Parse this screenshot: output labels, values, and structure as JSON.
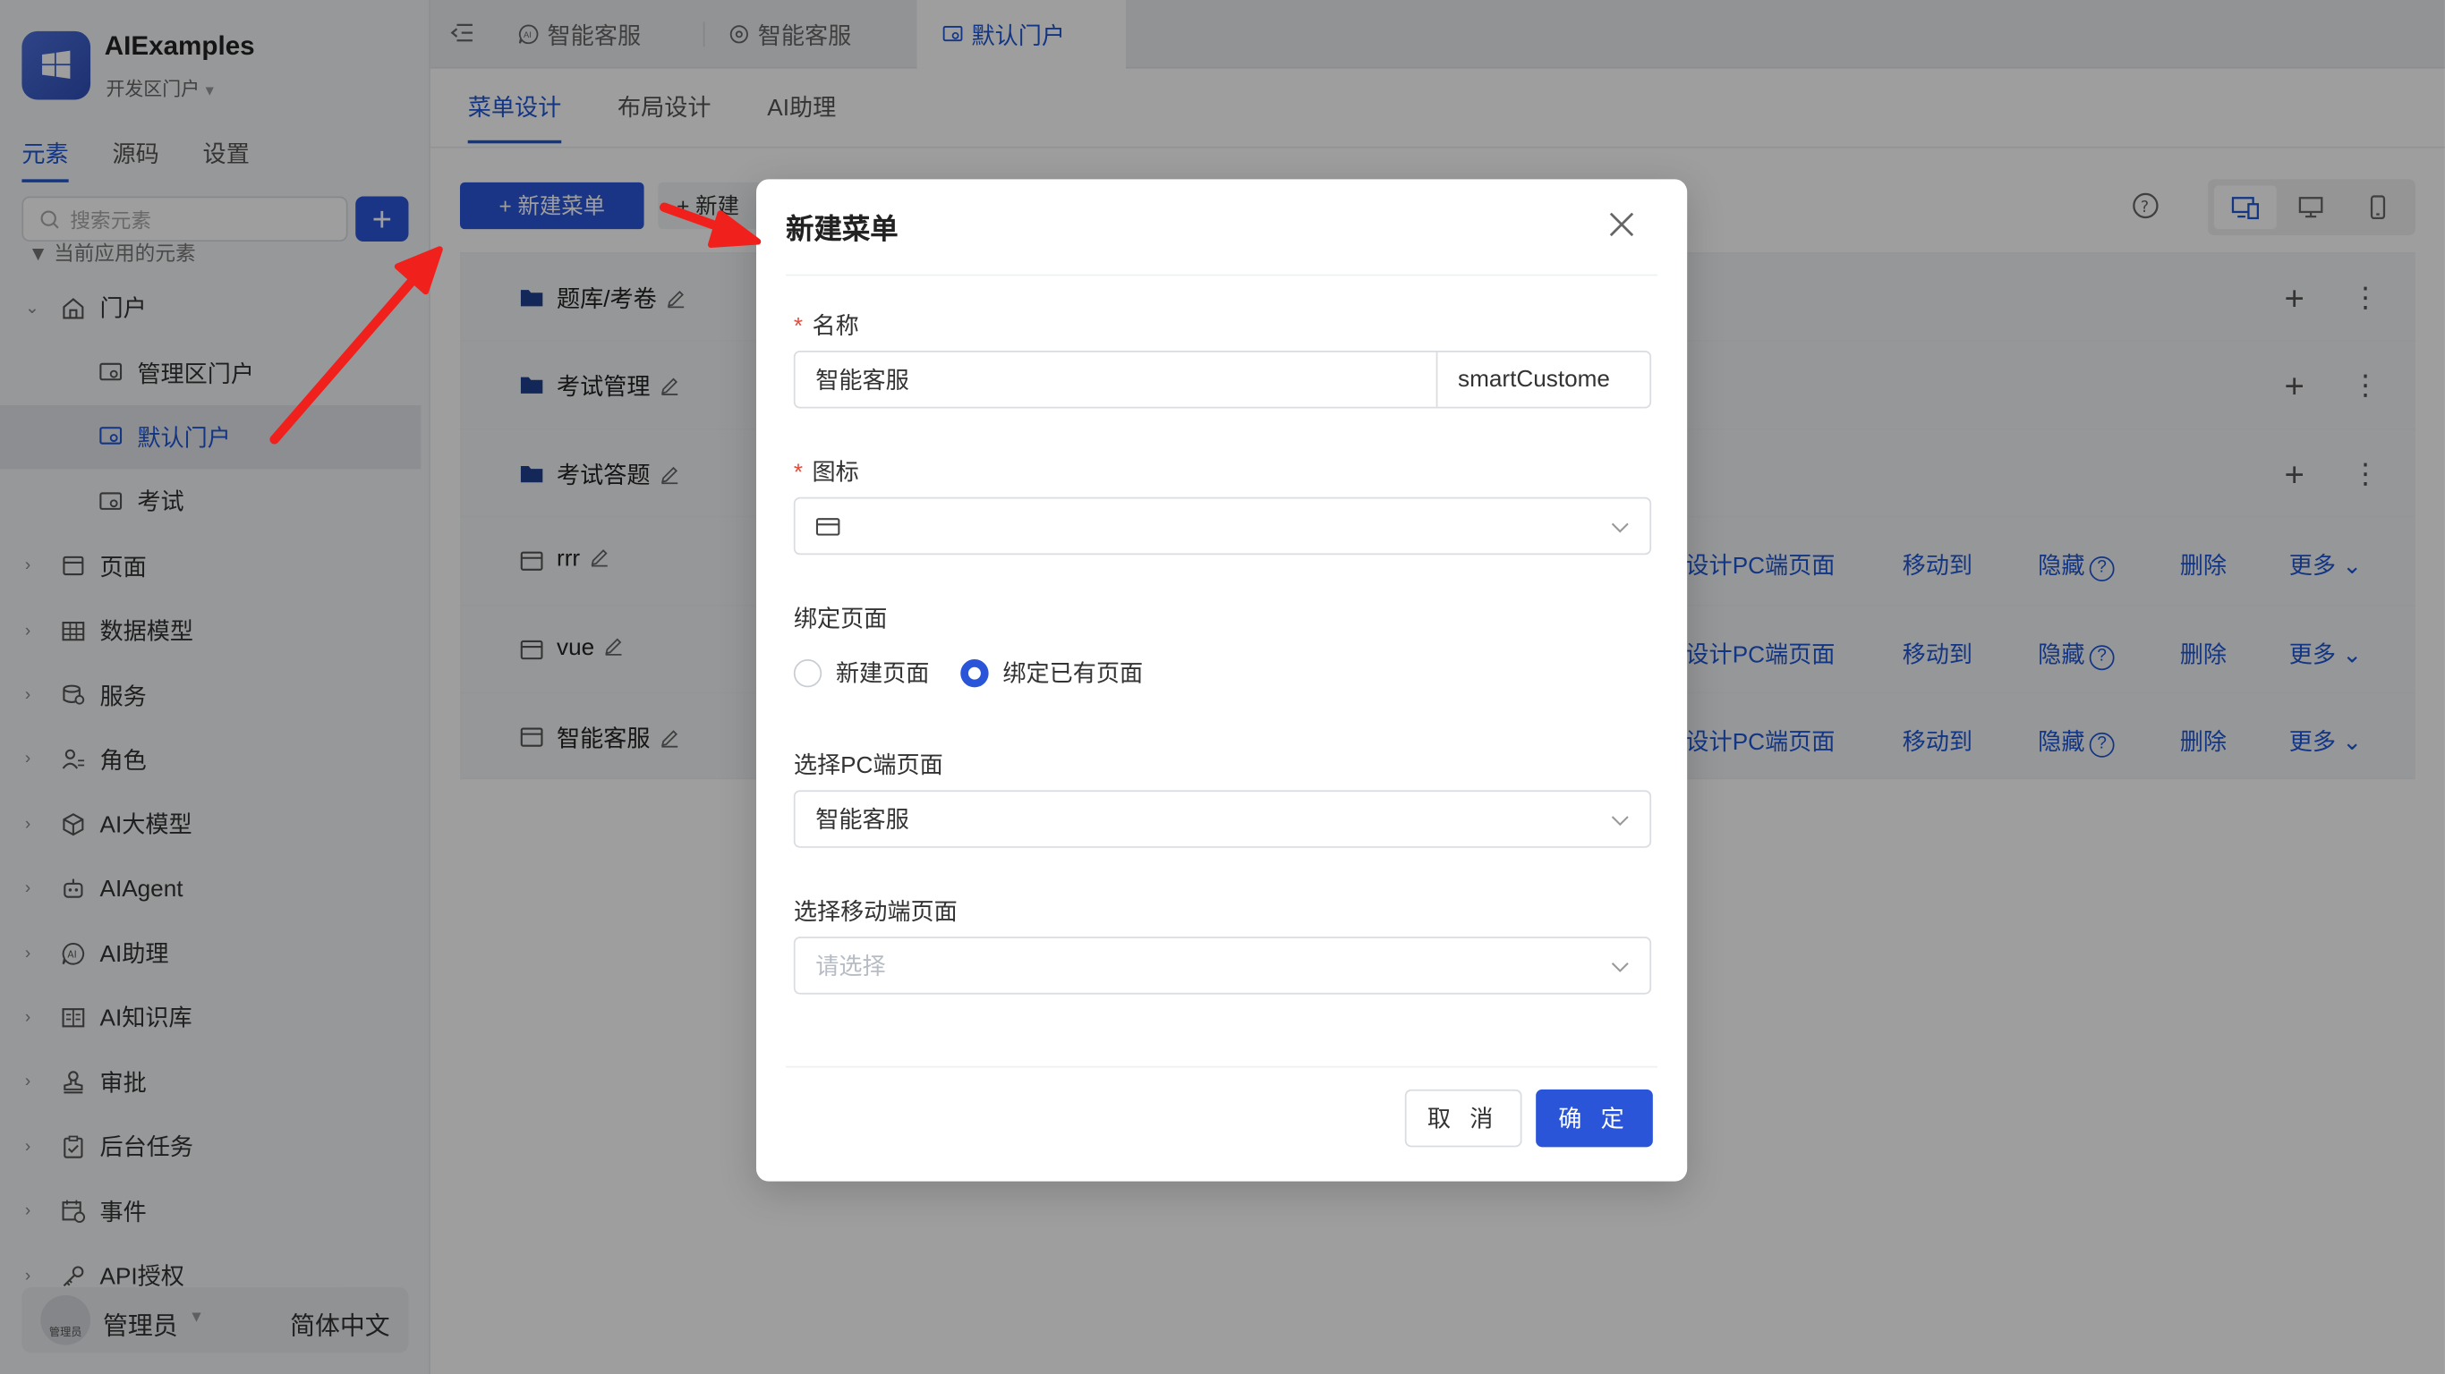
{
  "app": {
    "name": "AIExamples",
    "portal": "开发区门户"
  },
  "sidebar": {
    "tabs": [
      "元素",
      "源码",
      "设置"
    ],
    "search_placeholder": "搜索元素",
    "current_section": "当前应用的元素",
    "tree": [
      {
        "label": "门户",
        "icon": "home-icon",
        "expanded": true
      },
      {
        "label": "管理区门户",
        "icon": "portal-icon"
      },
      {
        "label": "默认门户",
        "icon": "portal-icon",
        "selected": true
      },
      {
        "label": "考试",
        "icon": "portal-icon"
      },
      {
        "label": "页面",
        "icon": "page-icon"
      },
      {
        "label": "数据模型",
        "icon": "table-icon"
      },
      {
        "label": "服务",
        "icon": "service-icon"
      },
      {
        "label": "角色",
        "icon": "role-icon"
      },
      {
        "label": "AI大模型",
        "icon": "cube-icon"
      },
      {
        "label": "AIAgent",
        "icon": "robot-icon"
      },
      {
        "label": "AI助理",
        "icon": "ai-assistant-icon"
      },
      {
        "label": "AI知识库",
        "icon": "book-icon"
      },
      {
        "label": "审批",
        "icon": "stamp-icon"
      },
      {
        "label": "后台任务",
        "icon": "task-icon"
      },
      {
        "label": "事件",
        "icon": "event-icon"
      },
      {
        "label": "API授权",
        "icon": "key-icon"
      }
    ],
    "footer": {
      "avatar_label": "管理员",
      "user": "管理员",
      "language": "简体中文"
    }
  },
  "topbar": {
    "tabs": [
      {
        "label": "智能客服",
        "icon": "ai-assistant-icon"
      },
      {
        "label": "智能客服",
        "icon": "page-icon"
      },
      {
        "label": "默认门户",
        "icon": "portal-icon",
        "active": true
      }
    ]
  },
  "main": {
    "subtabs": [
      "菜单设计",
      "布局设计",
      "AI助理"
    ],
    "new_menu_button": "+ 新建菜单",
    "new_second_button": "+ 新建",
    "rows": [
      {
        "label": "题库/考卷",
        "type": "folder"
      },
      {
        "label": "考试管理",
        "type": "folder"
      },
      {
        "label": "考试答题",
        "type": "folder"
      },
      {
        "label": "rrr",
        "type": "page"
      },
      {
        "label": "vue",
        "type": "page"
      },
      {
        "label": "智能客服",
        "type": "page"
      }
    ],
    "row_actions": {
      "design_pc": "设计PC端页面",
      "move_to": "移动到",
      "hide": "隐藏",
      "delete": "删除",
      "more": "更多"
    }
  },
  "modal": {
    "title": "新建菜单",
    "name_label": "名称",
    "name_value": "智能客服",
    "code_value": "smartCustome",
    "icon_label": "图标",
    "bind_label": "绑定页面",
    "radio_new": "新建页面",
    "radio_existing": "绑定已有页面",
    "pc_label": "选择PC端页面",
    "pc_value": "智能客服",
    "mobile_label": "选择移动端页面",
    "mobile_placeholder": "请选择",
    "cancel": "取 消",
    "ok": "确 定"
  },
  "colors": {
    "accent": "#2b55d8",
    "annotation_arrow": "#f0211d"
  }
}
